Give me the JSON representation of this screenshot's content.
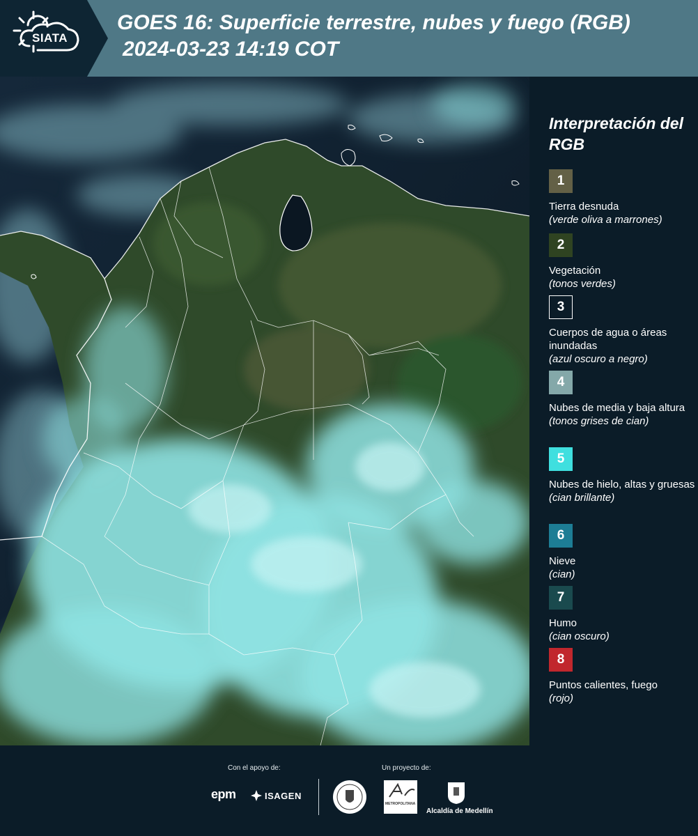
{
  "header": {
    "logo_text": "SIATA",
    "title_line1": "GOES 16: Superficie terrestre, nubes y fuego (RGB)",
    "title_line2": "2024-03-23 14:19 COT"
  },
  "legend": {
    "title": "Interpretación del RGB",
    "items": [
      {
        "num": "1",
        "label": "Tierra desnuda",
        "sub": "(verde oliva a marrones)",
        "color": "#636046"
      },
      {
        "num": "2",
        "label": "Vegetación",
        "sub": "(tonos verdes)",
        "color": "#2f4321"
      },
      {
        "num": "3",
        "label": "Cuerpos de agua o áreas inundadas",
        "sub": "(azul oscuro a negro)",
        "color": "#0b1c28"
      },
      {
        "num": "4",
        "label": "Nubes de media y baja altura",
        "sub": "(tonos grises de cian)",
        "color": "#84a8a9"
      },
      {
        "num": "5",
        "label": "Nubes de hielo, altas y gruesas",
        "sub": "(cian brillante)",
        "color": "#3fdfdf"
      },
      {
        "num": "6",
        "label": "Nieve",
        "sub": "(cian)",
        "color": "#1d7d95"
      },
      {
        "num": "7",
        "label": "Humo",
        "sub": "(cian oscuro)",
        "color": "#1a4a4e"
      },
      {
        "num": "8",
        "label": "Puntos calientes, fuego",
        "sub": "(rojo)",
        "color": "#c1272d"
      }
    ]
  },
  "footer": {
    "support_label": "Con el apoyo de:",
    "project_label": "Un proyecto de:",
    "logo_epm": "epm",
    "logo_isagen": "ISAGEN",
    "logo_metro": "METROPOLITANA",
    "logo_alcaldia": "Alcaldía de Medellín"
  }
}
